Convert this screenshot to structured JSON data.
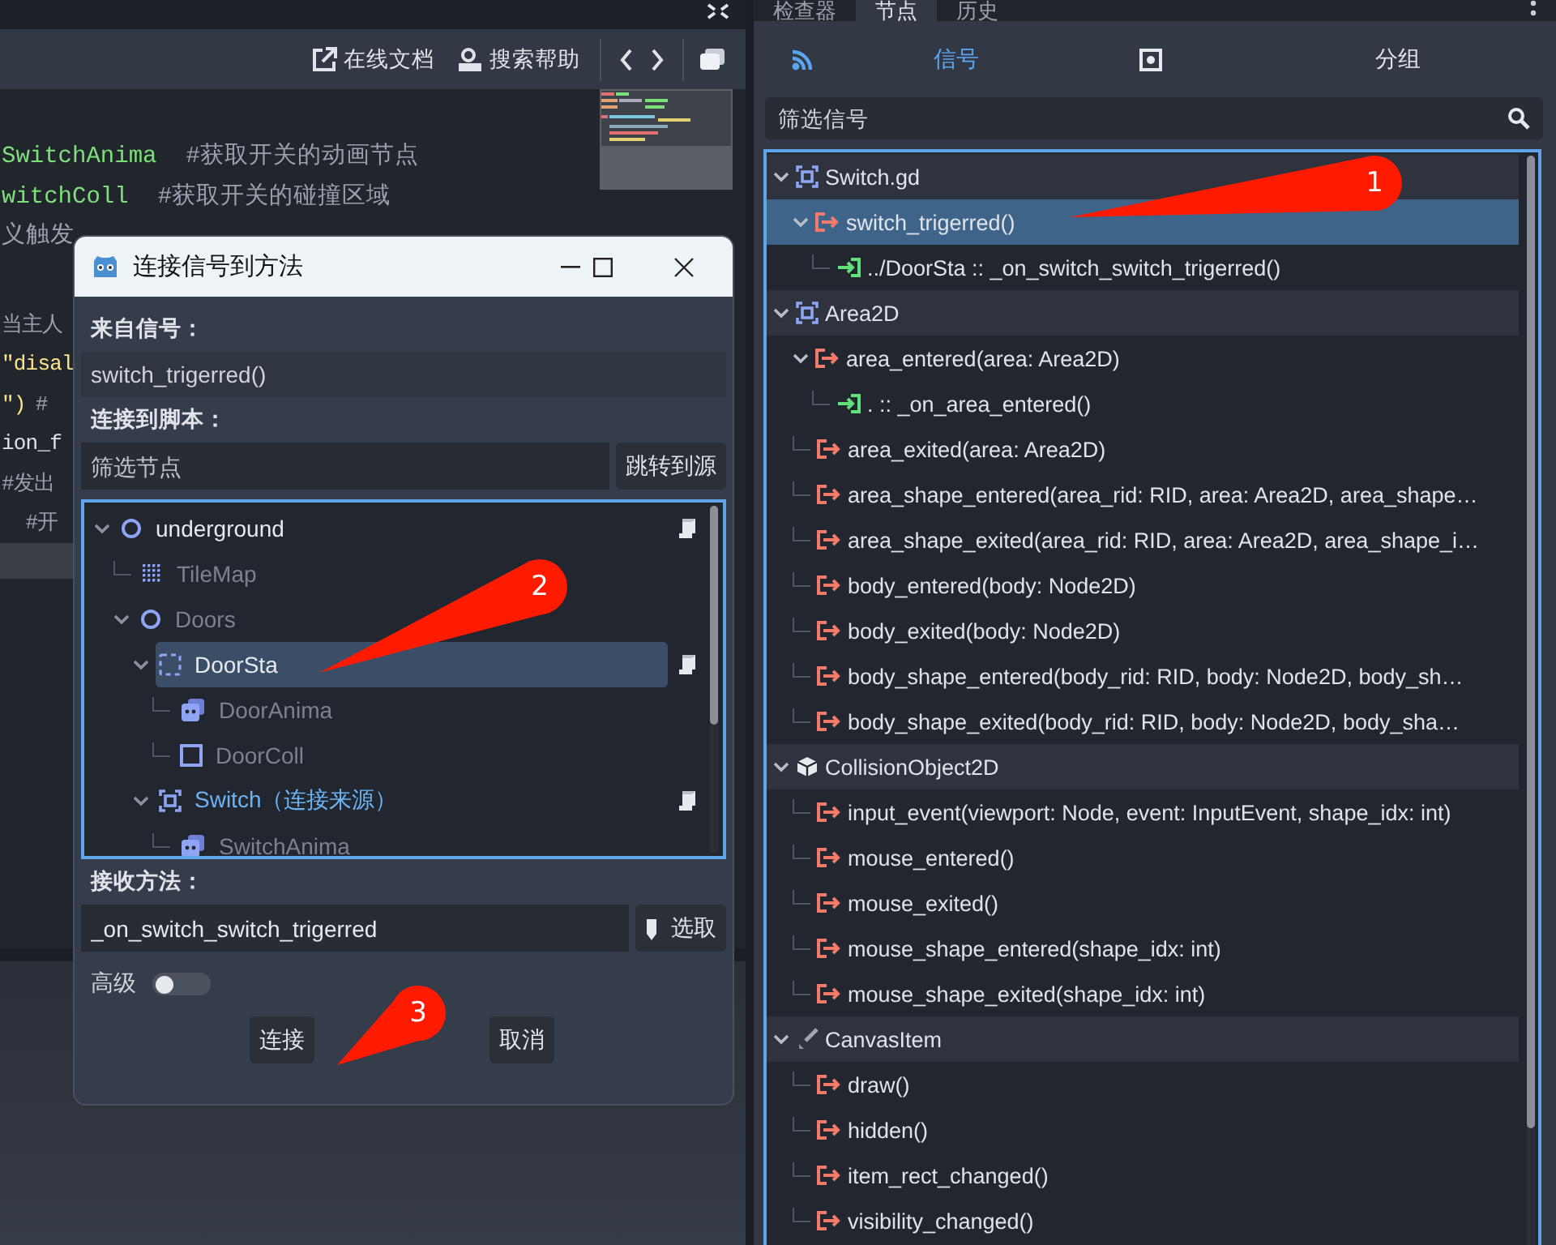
{
  "editor": {
    "toolbar": {
      "online_docs": "在线文档",
      "search_help": "搜索帮助"
    },
    "code_lines": [
      [
        {
          "kind": "ident",
          "text": "SwitchAnima"
        },
        {
          "kind": "comment",
          "text": "#获取开关的动画节点"
        }
      ],
      [
        {
          "kind": "ident",
          "text": "witchColl"
        },
        {
          "kind": "comment",
          "text": "#获取开关的碰撞区域"
        }
      ],
      [
        {
          "kind": "comment",
          "text": "义触发"
        }
      ],
      [
        {
          "kind": "comment",
          "text": "当主人"
        }
      ],
      [
        {
          "kind": "string",
          "text": "\"disal"
        }
      ],
      [
        {
          "kind": "string",
          "text": "\")"
        },
        {
          "kind": "comment",
          "text": "#"
        }
      ],
      [
        {
          "kind": "plain",
          "text": "ion_f"
        }
      ],
      [
        {
          "kind": "comment",
          "text": "#发出"
        }
      ],
      [
        {
          "kind": "comment",
          "text": "  #开"
        }
      ]
    ]
  },
  "dialog": {
    "title": "连接信号到方法",
    "from_label": "来自信号：",
    "from_value": "switch_trigerred()",
    "script_label": "连接到脚本：",
    "filter_placeholder": "筛选节点",
    "goto_button": "跳转到源",
    "nodes": [
      {
        "name": "underground",
        "selected": false,
        "expanded": true,
        "has_script": true,
        "disabled": false,
        "source": false,
        "children": [
          {
            "name": "TileMap",
            "selected": false,
            "has_script": false,
            "disabled": true,
            "source": false
          },
          {
            "name": "Doors",
            "selected": false,
            "expanded": true,
            "has_script": false,
            "disabled": true,
            "source": false,
            "children": [
              {
                "name": "DoorSta",
                "selected": true,
                "expanded": true,
                "has_script": true,
                "disabled": false,
                "source": false,
                "children": [
                  {
                    "name": "DoorAnima",
                    "selected": false,
                    "has_script": false,
                    "disabled": true,
                    "source": false
                  },
                  {
                    "name": "DoorColl",
                    "selected": false,
                    "has_script": false,
                    "disabled": true,
                    "source": false
                  }
                ]
              },
              {
                "name": "Switch（连接来源）",
                "selected": false,
                "expanded": true,
                "has_script": true,
                "disabled": false,
                "source": true,
                "children": [
                  {
                    "name": "SwitchAnima",
                    "selected": false,
                    "has_script": false,
                    "disabled": true,
                    "source": false
                  }
                ]
              }
            ]
          }
        ]
      }
    ],
    "method_label": "接收方法：",
    "method_value": "_on_switch_switch_trigerred",
    "pick_button": "选取",
    "advanced": {
      "label": "高级",
      "on": false
    },
    "buttons": [
      "连接",
      "取消"
    ]
  },
  "dock_tabs": [
    {
      "label": "检查器",
      "selected": false
    },
    {
      "label": "节点",
      "selected": true
    },
    {
      "label": "历史",
      "selected": false
    }
  ],
  "node_tabs": [
    {
      "label": "信号",
      "selected": true
    },
    {
      "label": "分组",
      "selected": false
    }
  ],
  "signal_filter": {
    "placeholder": "筛选信号"
  },
  "signal_tree": [
    {
      "kind": "class",
      "text": "Switch.gd",
      "selected": false,
      "expanded": true,
      "children": [
        {
          "kind": "signal",
          "text": "switch_trigerred()",
          "selected": true,
          "expanded": true,
          "children": [
            {
              "kind": "connection",
              "text": "../DoorSta :: _on_switch_switch_trigerred()",
              "selected": false
            }
          ]
        }
      ]
    },
    {
      "kind": "class",
      "text": "Area2D",
      "selected": false,
      "expanded": true,
      "children": [
        {
          "kind": "signal",
          "text": "area_entered(area: Area2D)",
          "selected": false,
          "expanded": true,
          "children": [
            {
              "kind": "connection",
              "text": ". :: _on_area_entered()",
              "selected": false
            }
          ]
        },
        {
          "kind": "signal",
          "text": "area_exited(area: Area2D)",
          "selected": false
        },
        {
          "kind": "signal",
          "text": "area_shape_entered(area_rid: RID, area: Area2D, area_shape…",
          "selected": false
        },
        {
          "kind": "signal",
          "text": "area_shape_exited(area_rid: RID, area: Area2D, area_shape_i…",
          "selected": false
        },
        {
          "kind": "signal",
          "text": "body_entered(body: Node2D)",
          "selected": false
        },
        {
          "kind": "signal",
          "text": "body_exited(body: Node2D)",
          "selected": false
        },
        {
          "kind": "signal",
          "text": "body_shape_entered(body_rid: RID, body: Node2D, body_sh…",
          "selected": false
        },
        {
          "kind": "signal",
          "text": "body_shape_exited(body_rid: RID, body: Node2D, body_sha…",
          "selected": false
        }
      ]
    },
    {
      "kind": "class",
      "text": "CollisionObject2D",
      "selected": false,
      "expanded": true,
      "children": [
        {
          "kind": "signal",
          "text": "input_event(viewport: Node, event: InputEvent, shape_idx: int)",
          "selected": false
        },
        {
          "kind": "signal",
          "text": "mouse_entered()",
          "selected": false
        },
        {
          "kind": "signal",
          "text": "mouse_exited()",
          "selected": false
        },
        {
          "kind": "signal",
          "text": "mouse_shape_entered(shape_idx: int)",
          "selected": false
        },
        {
          "kind": "signal",
          "text": "mouse_shape_exited(shape_idx: int)",
          "selected": false
        }
      ]
    },
    {
      "kind": "class",
      "text": "CanvasItem",
      "selected": false,
      "expanded": true,
      "children": [
        {
          "kind": "signal",
          "text": "draw()",
          "selected": false
        },
        {
          "kind": "signal",
          "text": "hidden()",
          "selected": false
        },
        {
          "kind": "signal",
          "text": "item_rect_changed()",
          "selected": false
        },
        {
          "kind": "signal",
          "text": "visibility_changed()",
          "selected": false
        }
      ]
    }
  ],
  "annotations": [
    {
      "label": "1"
    },
    {
      "label": "2"
    },
    {
      "label": "3"
    }
  ]
}
